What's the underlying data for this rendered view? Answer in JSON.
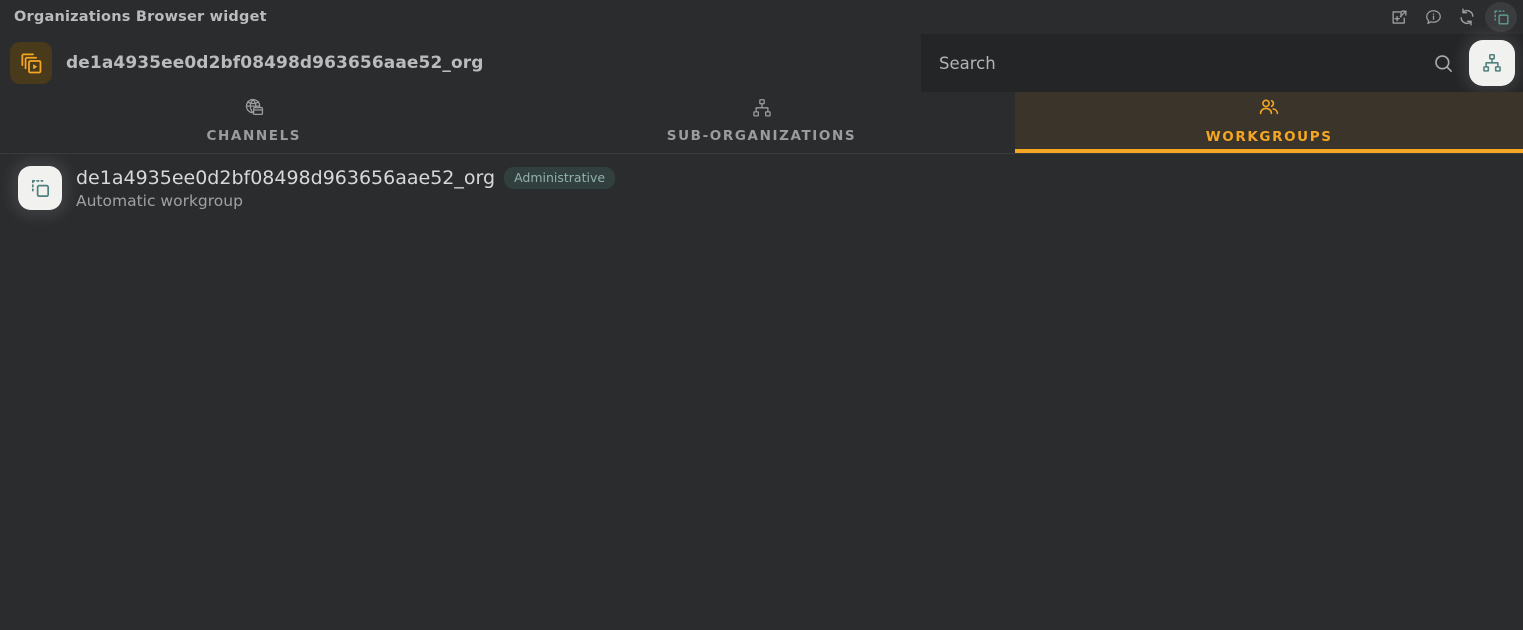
{
  "window": {
    "title": "Organizations Browser widget",
    "background_color": "#2b2c2e",
    "accent_color": "#f5a623",
    "teal_color": "#4e817b",
    "actions": [
      {
        "name": "add-to-window-icon",
        "tooltip": "Open in new window",
        "active": false
      },
      {
        "name": "info-bubble-icon",
        "tooltip": "Info",
        "active": false
      },
      {
        "name": "refresh-icon",
        "tooltip": "Refresh",
        "active": false
      },
      {
        "name": "duplicate-widget-icon",
        "tooltip": "Duplicate widget",
        "active": true
      }
    ]
  },
  "header": {
    "org_icon": "organizations-icon",
    "org_name": "de1a4935ee0d2bf08498d963656aae52_org",
    "org_icon_color": "#f5a623",
    "org_icon_background": "#4a3a1c"
  },
  "search": {
    "value": "",
    "placeholder": "Search",
    "icon": "search-icon"
  },
  "hierarchy_button": {
    "icon": "sitemap-icon",
    "label": "Hierarchy view",
    "active": true
  },
  "tabs": [
    {
      "label": "CHANNELS",
      "icon": "globe-window-icon",
      "active": false
    },
    {
      "label": "SUB-ORGANIZATIONS",
      "icon": "sitemap-icon",
      "active": false
    },
    {
      "label": "WORKGROUPS",
      "icon": "people-icon",
      "active": true
    }
  ],
  "list": {
    "rows": [
      {
        "icon": "duplicate-widget-icon",
        "title": "de1a4935ee0d2bf08498d963656aae52_org",
        "badge": "Administrative",
        "subtitle": "Automatic workgroup"
      }
    ]
  }
}
